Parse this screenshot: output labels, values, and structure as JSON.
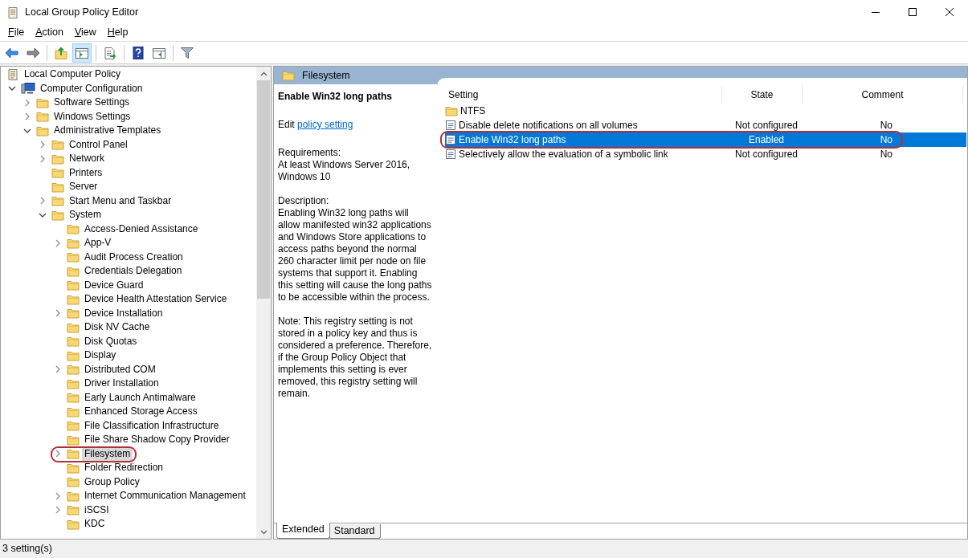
{
  "window": {
    "title": "Local Group Policy Editor"
  },
  "menu": [
    "File",
    "Action",
    "View",
    "Help"
  ],
  "toolbar": [
    {
      "kind": "back",
      "pressed": false
    },
    {
      "kind": "forward",
      "pressed": false
    },
    {
      "kind": "sep"
    },
    {
      "kind": "up",
      "pressed": false
    },
    {
      "kind": "tree",
      "pressed": true
    },
    {
      "kind": "sep"
    },
    {
      "kind": "export",
      "pressed": false
    },
    {
      "kind": "sep"
    },
    {
      "kind": "help",
      "pressed": false
    },
    {
      "kind": "pane",
      "pressed": false
    },
    {
      "kind": "sep"
    },
    {
      "kind": "filter",
      "pressed": false
    }
  ],
  "tree": [
    {
      "label": "Local Computer Policy",
      "kind": "policy",
      "selected": false,
      "highlighted": false,
      "children": [
        {
          "label": "Computer Configuration",
          "kind": "computer",
          "expanded": true,
          "selected": false,
          "highlighted": false,
          "children": [
            {
              "label": "Software Settings",
              "kind": "folder",
              "expanded": false,
              "selected": false,
              "highlighted": false
            },
            {
              "label": "Windows Settings",
              "kind": "folder",
              "expanded": false,
              "selected": false,
              "highlighted": false
            },
            {
              "label": "Administrative Templates",
              "kind": "folder",
              "expanded": true,
              "selected": false,
              "highlighted": false,
              "children": [
                {
                  "label": "Control Panel",
                  "kind": "folder",
                  "expanded": false,
                  "selected": false,
                  "highlighted": false
                },
                {
                  "label": "Network",
                  "kind": "folder",
                  "expanded": false,
                  "selected": false,
                  "highlighted": false
                },
                {
                  "label": "Printers",
                  "kind": "folder",
                  "selected": false,
                  "highlighted": false
                },
                {
                  "label": "Server",
                  "kind": "folder",
                  "selected": false,
                  "highlighted": false
                },
                {
                  "label": "Start Menu and Taskbar",
                  "kind": "folder",
                  "expanded": false,
                  "selected": false,
                  "highlighted": false
                },
                {
                  "label": "System",
                  "kind": "folder",
                  "expanded": true,
                  "selected": false,
                  "highlighted": false,
                  "children": [
                    {
                      "label": "Access-Denied Assistance",
                      "kind": "folder",
                      "selected": false,
                      "highlighted": false
                    },
                    {
                      "label": "App-V",
                      "kind": "folder",
                      "expanded": false,
                      "selected": false,
                      "highlighted": false
                    },
                    {
                      "label": "Audit Process Creation",
                      "kind": "folder",
                      "selected": false,
                      "highlighted": false
                    },
                    {
                      "label": "Credentials Delegation",
                      "kind": "folder",
                      "selected": false,
                      "highlighted": false
                    },
                    {
                      "label": "Device Guard",
                      "kind": "folder",
                      "selected": false,
                      "highlighted": false
                    },
                    {
                      "label": "Device Health Attestation Service",
                      "kind": "folder",
                      "selected": false,
                      "highlighted": false
                    },
                    {
                      "label": "Device Installation",
                      "kind": "folder",
                      "expanded": false,
                      "selected": false,
                      "highlighted": false
                    },
                    {
                      "label": "Disk NV Cache",
                      "kind": "folder",
                      "selected": false,
                      "highlighted": false
                    },
                    {
                      "label": "Disk Quotas",
                      "kind": "folder",
                      "selected": false,
                      "highlighted": false
                    },
                    {
                      "label": "Display",
                      "kind": "folder",
                      "selected": false,
                      "highlighted": false
                    },
                    {
                      "label": "Distributed COM",
                      "kind": "folder",
                      "expanded": false,
                      "selected": false,
                      "highlighted": false
                    },
                    {
                      "label": "Driver Installation",
                      "kind": "folder",
                      "selected": false,
                      "highlighted": false
                    },
                    {
                      "label": "Early Launch Antimalware",
                      "kind": "folder",
                      "selected": false,
                      "highlighted": false
                    },
                    {
                      "label": "Enhanced Storage Access",
                      "kind": "folder",
                      "selected": false,
                      "highlighted": false
                    },
                    {
                      "label": "File Classification Infrastructure",
                      "kind": "folder",
                      "selected": false,
                      "highlighted": false
                    },
                    {
                      "label": "File Share Shadow Copy Provider",
                      "kind": "folder",
                      "selected": false,
                      "highlighted": false
                    },
                    {
                      "label": "Filesystem",
                      "kind": "folder",
                      "expanded": false,
                      "selected": true,
                      "highlighted": true
                    },
                    {
                      "label": "Folder Redirection",
                      "kind": "folder",
                      "selected": false,
                      "highlighted": false
                    },
                    {
                      "label": "Group Policy",
                      "kind": "folder",
                      "selected": false,
                      "highlighted": false
                    },
                    {
                      "label": "Internet Communication Management",
                      "kind": "folder",
                      "expanded": false,
                      "selected": false,
                      "highlighted": false
                    },
                    {
                      "label": "iSCSI",
                      "kind": "folder",
                      "expanded": false,
                      "selected": false,
                      "highlighted": false
                    },
                    {
                      "label": "KDC",
                      "kind": "folder",
                      "selected": false,
                      "highlighted": false
                    }
                  ]
                }
              ]
            }
          ]
        }
      ]
    }
  ],
  "header": {
    "title": "Filesystem"
  },
  "description": {
    "title": "Enable Win32 long paths",
    "edit_prefix": "Edit",
    "edit_link": "policy setting",
    "paragraphs": [
      "Requirements:\nAt least Windows Server 2016, Windows 10",
      "Description:\nEnabling Win32 long paths will allow manifested win32 applications and Windows Store applications to access paths beyond the normal 260 character limit per node on file systems that support it.  Enabling this setting will cause the long paths to be accessible within the process.",
      "Note:  This registry setting is not stored in a policy key and thus is considered a preference.  Therefore, if the Group Policy Object that implements this setting is ever removed, this registry setting will remain."
    ]
  },
  "table": {
    "columns": [
      "Setting",
      "State",
      "Comment"
    ],
    "rows": [
      {
        "kind": "folder",
        "setting": "NTFS",
        "selected": false,
        "highlighted": false
      },
      {
        "kind": "policy",
        "setting": "Disable delete notifications on all volumes",
        "state": "Not configured",
        "comment": "No",
        "selected": false,
        "highlighted": false
      },
      {
        "kind": "policy",
        "setting": "Enable Win32 long paths",
        "state": "Enabled",
        "comment": "No",
        "selected": true,
        "highlighted": true
      },
      {
        "kind": "policy",
        "setting": "Selectively allow the evaluation of a symbolic link",
        "state": "Not configured",
        "comment": "No",
        "selected": false,
        "highlighted": false
      }
    ]
  },
  "view_tabs": [
    {
      "label": "Extended",
      "selected": true
    },
    {
      "label": "Standard",
      "selected": false
    }
  ],
  "status_bar": "3 setting(s)"
}
